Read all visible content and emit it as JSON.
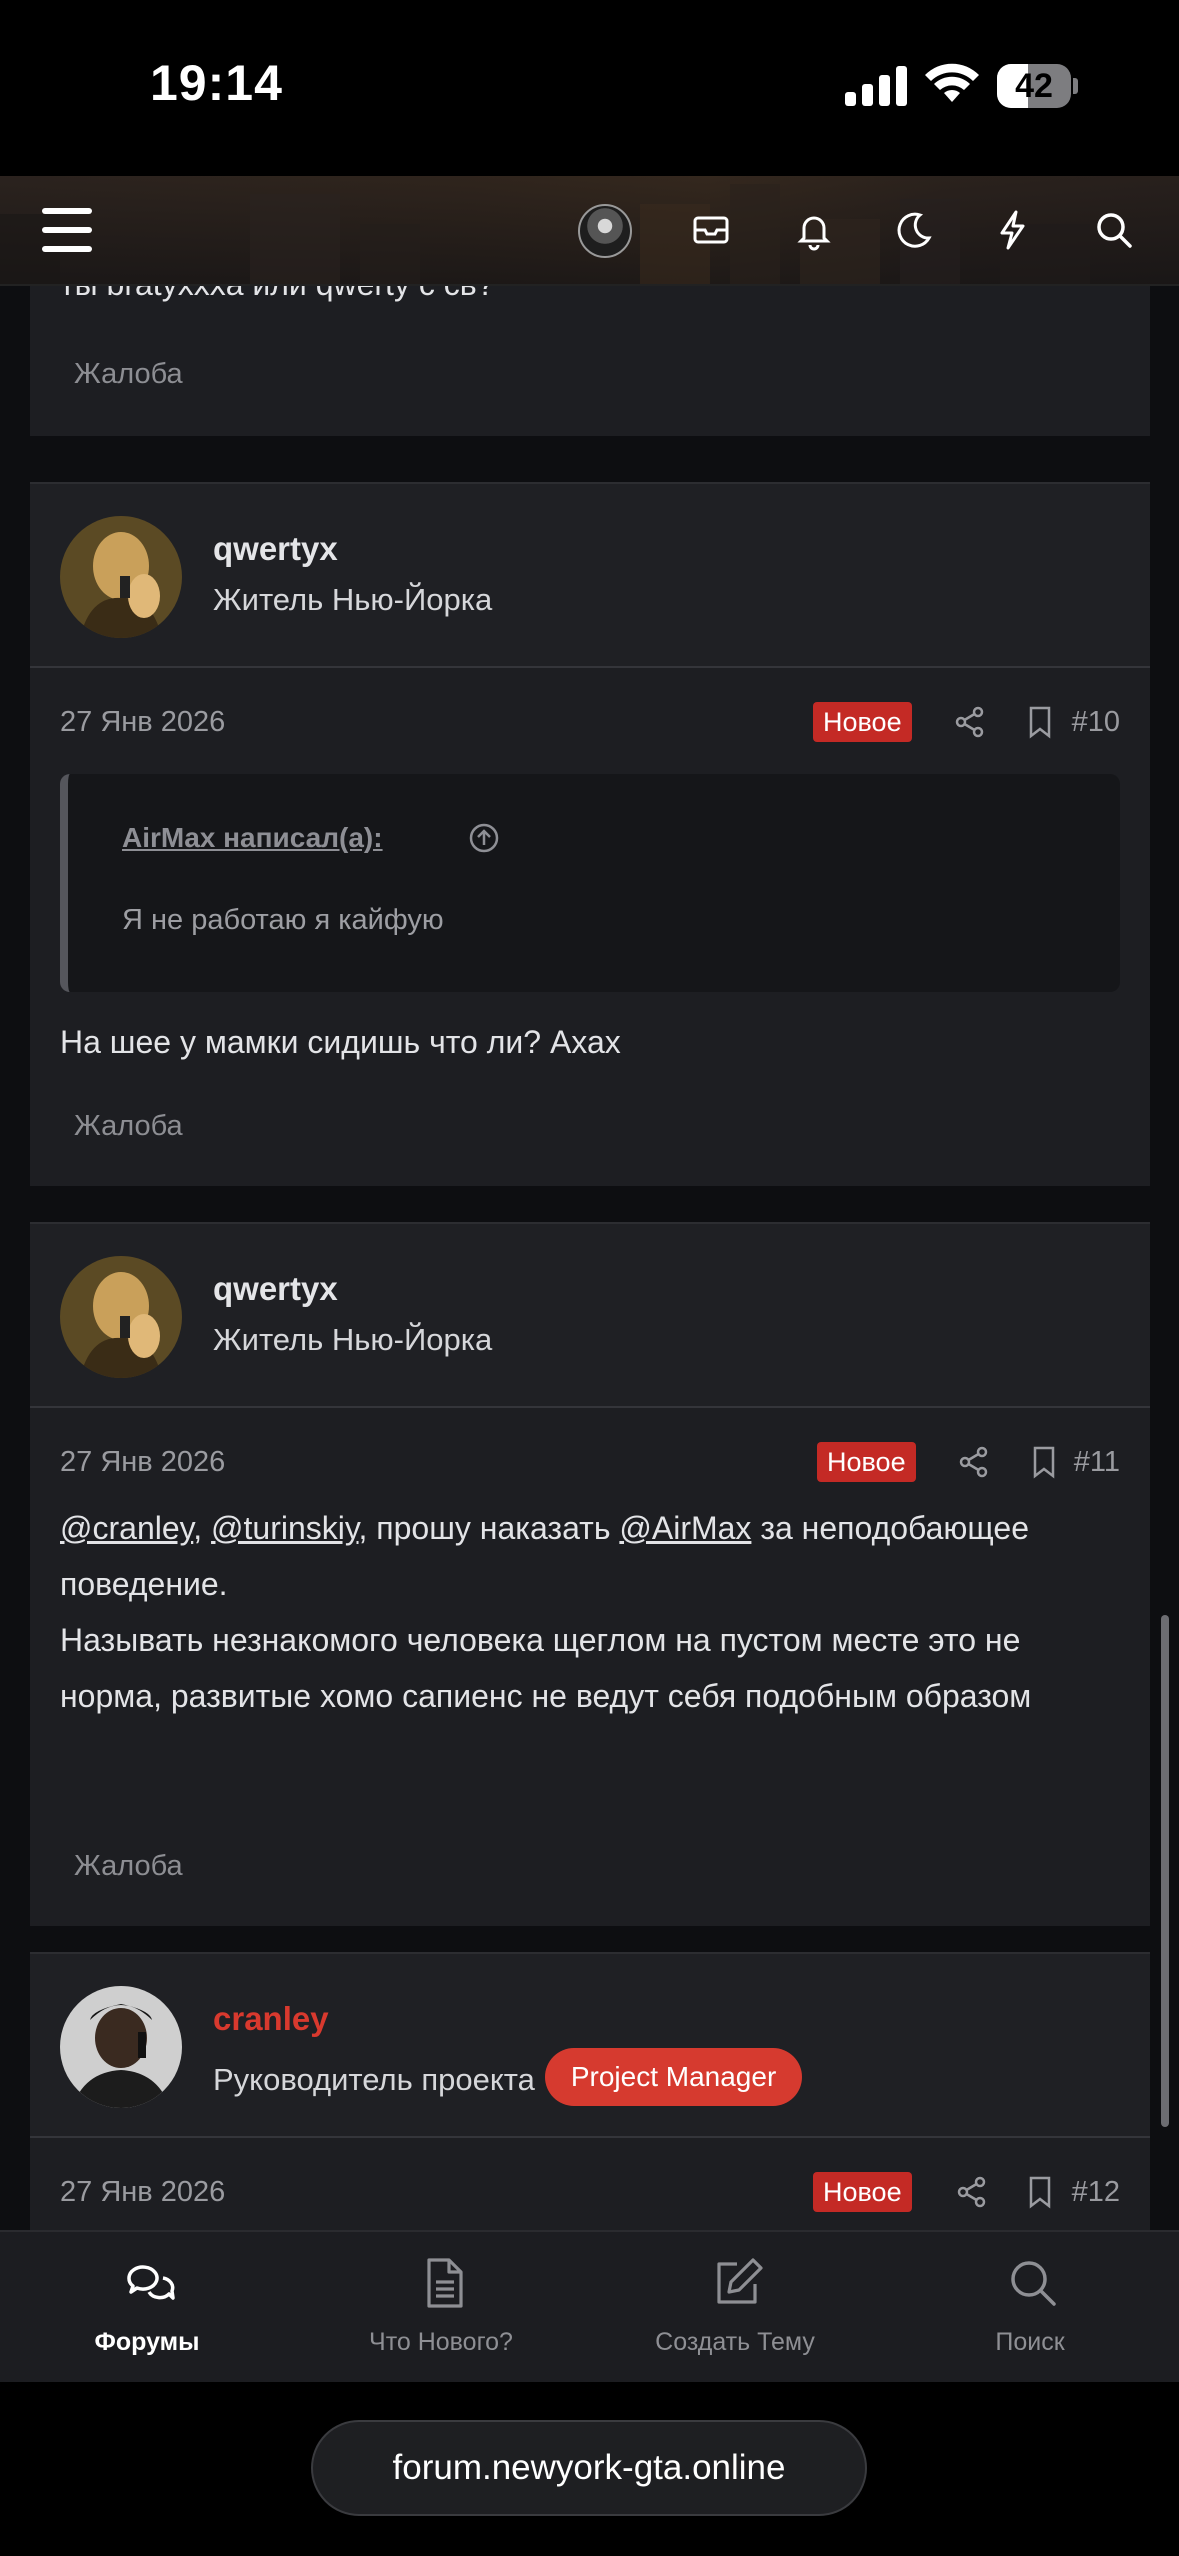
{
  "status_bar": {
    "time": "19:14",
    "battery": "42",
    "battery_level": 0.42
  },
  "header": {
    "icons": [
      "menu-icon",
      "avatar",
      "mail-icon",
      "bell-icon",
      "moon-icon",
      "bolt-icon",
      "search-icon"
    ]
  },
  "posts": [
    {
      "partial_text": "ты bratyxxxa или qwerty с св?",
      "report_label": "Жалоба"
    },
    {
      "username": "qwertyx",
      "user_title": "Житель Нью-Йорка",
      "date": "27 Янв 2026",
      "new_label": "Новое",
      "number": "#10",
      "quote": {
        "author": "AirMax написал(а):",
        "text": "Я не работаю я кайфую"
      },
      "text": "На шее у мамки сидишь что ли? Ахах",
      "report_label": "Жалоба"
    },
    {
      "username": "qwertyx",
      "user_title": "Житель Нью-Йорка",
      "date": "27 Янв 2026",
      "new_label": "Новое",
      "number": "#11",
      "mention1": "@cranley",
      "sep1": ", ",
      "mention2": "@turinskiy",
      "mid_text": ", прошу наказать ",
      "mention3": "@AirMax",
      "tail_text": " за неподобающее поведение.",
      "text_line2": "Называть незнакомого человека щеглом на пустом месте это не норма, развитые хомо сапиенс не ведут себя подобным образом",
      "report_label": "Жалоба"
    },
    {
      "username": "cranley",
      "user_title": "Руководитель проекта",
      "role_badge": "Project Manager",
      "date": "27 Янв 2026",
      "new_label": "Новое",
      "number": "#12"
    }
  ],
  "tabbar": {
    "tabs": [
      {
        "label": "Форумы",
        "icon": "forums-icon",
        "active": true
      },
      {
        "label": "Что Нового?",
        "icon": "document-icon",
        "active": false
      },
      {
        "label": "Создать Тему",
        "icon": "edit-icon",
        "active": false
      },
      {
        "label": "Поиск",
        "icon": "search-icon",
        "active": false
      }
    ]
  },
  "browser": {
    "url": "forum.newyork-gta.online"
  },
  "colors": {
    "accent": "#d63a2f",
    "new_badge": "#c42a25",
    "background": "#0d0e11",
    "card": "#1d1e22"
  }
}
